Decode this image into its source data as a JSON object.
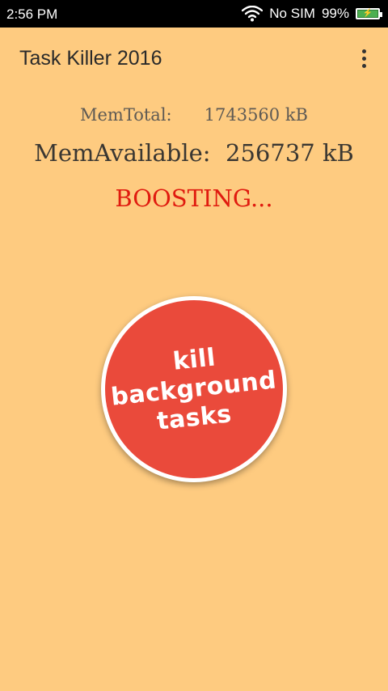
{
  "status_bar": {
    "time": "2:56 PM",
    "carrier": "No SIM",
    "battery_percent": "99%",
    "battery_level": 0.99,
    "icons": [
      "wifi-icon",
      "battery-charging-icon"
    ]
  },
  "app_bar": {
    "title": "Task Killer 2016",
    "menu_icon": "overflow-menu-icon"
  },
  "memory": {
    "total_label": "MemTotal:",
    "total_value": "1743560 kB",
    "available_label": "MemAvailable:",
    "available_value": "256737 kB"
  },
  "status_text": "BOOSTING...",
  "kill_button": {
    "line1": "kill",
    "line2": "background",
    "line3": "tasks",
    "color": "#ea4a3b"
  },
  "colors": {
    "background": "#fecb80",
    "status_text": "#e01b0f"
  }
}
